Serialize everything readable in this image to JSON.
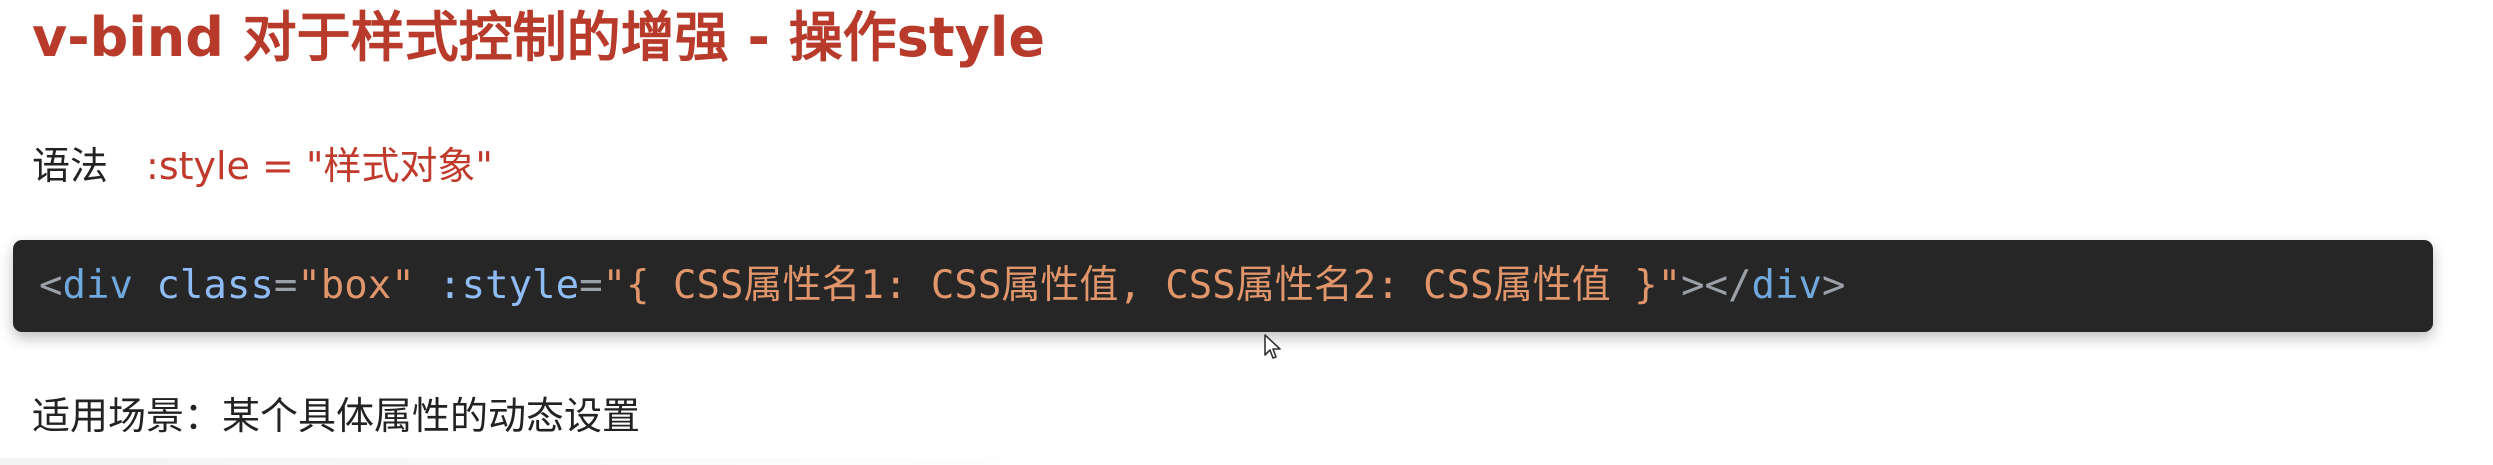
{
  "heading": {
    "title": "v-bind 对于样式控制的增强 - 操作style"
  },
  "syntax": {
    "label": "语法",
    "code": ":style = \"样式对象\""
  },
  "code_block": {
    "open_bracket": "<",
    "tag_open": "div",
    "attr_class": "class",
    "eq1": "=",
    "val_class": "\"box\"",
    "attr_style": ":style",
    "eq2": "=",
    "val_style": "\"{ CSS属性名1: CSS属性值, CSS属性名2: CSS属性值 }\"",
    "close_open": "></",
    "tag_close": "div",
    "close_bracket": ">"
  },
  "scenario": {
    "text": "适用场景：某个具体属性的动态设置"
  },
  "colors": {
    "title": "#b83a2b",
    "syntax_code": "#c0392b",
    "code_background": "#262626"
  }
}
